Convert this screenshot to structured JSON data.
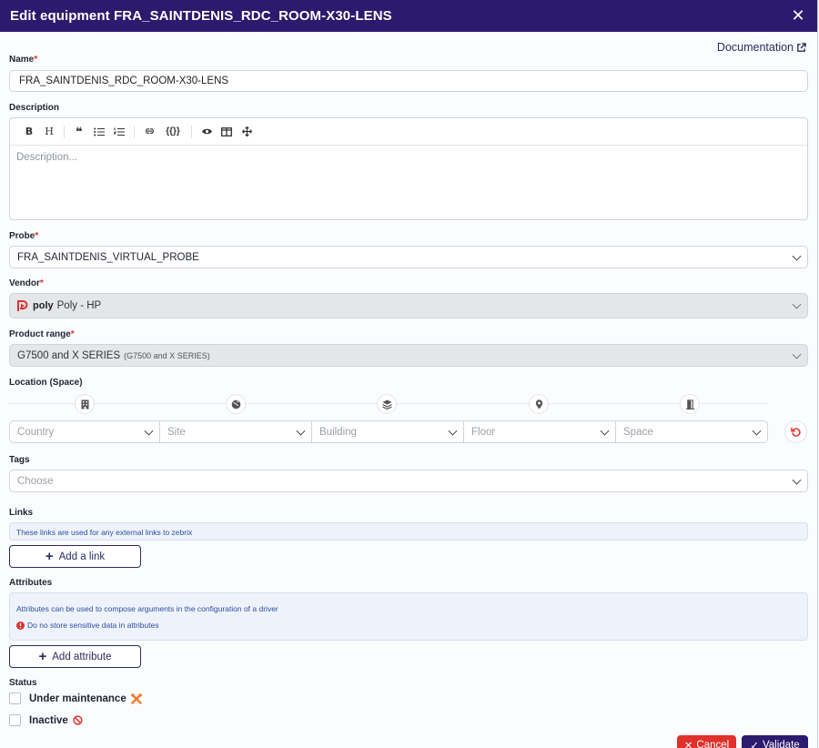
{
  "header": {
    "title": "Edit equipment FRA_SAINTDENIS_RDC_ROOM-X30-LENS",
    "close_glyph": "✕"
  },
  "documentation": {
    "label": "Documentation"
  },
  "name": {
    "label": "Name",
    "required": "*",
    "value": "FRA_SAINTDENIS_RDC_ROOM-X30-LENS"
  },
  "description": {
    "label": "Description",
    "placeholder": "Description...",
    "toolbar": {
      "bold": "B",
      "heading": "H",
      "quote": "❝",
      "code": "{{}}"
    }
  },
  "probe": {
    "label": "Probe",
    "required": "*",
    "value": "FRA_SAINTDENIS_VIRTUAL_PROBE"
  },
  "vendor": {
    "label": "Vendor",
    "required": "*",
    "logo_text": "poly",
    "value": "Poly - HP"
  },
  "product_range": {
    "label": "Product range",
    "required": "*",
    "value": "G7500 and X SERIES",
    "sub": "(G7500 and X SERIES)"
  },
  "location": {
    "label": "Location (Space)",
    "selects": [
      {
        "placeholder": "Country"
      },
      {
        "placeholder": "Site"
      },
      {
        "placeholder": "Building"
      },
      {
        "placeholder": "Floor"
      },
      {
        "placeholder": "Space"
      }
    ]
  },
  "tags": {
    "label": "Tags",
    "placeholder": "Choose"
  },
  "links": {
    "label": "Links",
    "info": "These links are used for any external links to zebrix",
    "add_label": "Add a link"
  },
  "attributes": {
    "label": "Attributes",
    "info": "Attributes can be used to compose arguments in the configuration of a driver",
    "warning": "Do no store sensitive data in attributes",
    "add_label": "Add attribute"
  },
  "status": {
    "label": "Status",
    "maintenance": "Under maintenance",
    "inactive": "Inactive"
  },
  "footer": {
    "cancel": "Cancel",
    "validate": "Validate"
  },
  "colors": {
    "header": "#2c1a6e",
    "danger": "#e0312b",
    "primary": "#2b2a5e"
  }
}
